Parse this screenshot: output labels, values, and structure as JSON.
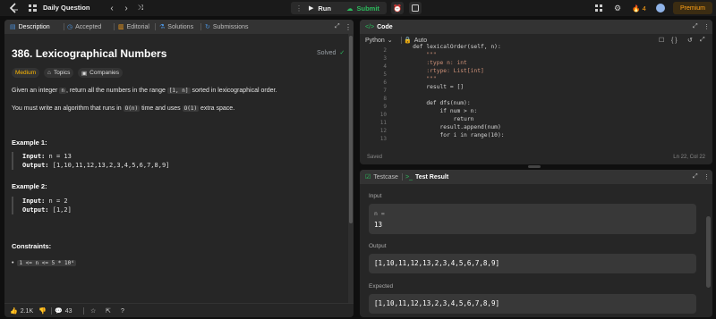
{
  "topbar": {
    "title": "Daily Question",
    "run_label": "Run",
    "submit_label": "Submit",
    "streak": "4",
    "premium_label": "Premium"
  },
  "left_tabs": [
    "Description",
    "Accepted",
    "Editorial",
    "Solutions",
    "Submissions"
  ],
  "problem": {
    "title": "386. Lexicographical Numbers",
    "status": "Solved",
    "difficulty": "Medium",
    "topics_label": "Topics",
    "companies_label": "Companies",
    "p1_a": "Given an integer",
    "p1_code1": "n",
    "p1_b": ", return all the numbers in the range",
    "p1_code2": "[1, n]",
    "p1_c": "sorted in lexicographical order.",
    "p2_a": "You must write an algorithm that runs in",
    "p2_code1": "O(n)",
    "p2_b": "time and uses",
    "p2_code2": "O(1)",
    "p2_c": "extra space.",
    "ex1_title": "Example 1:",
    "ex1_input_label": "Input:",
    "ex1_input": "n = 13",
    "ex1_output_label": "Output:",
    "ex1_output": "[1,10,11,12,13,2,3,4,5,6,7,8,9]",
    "ex2_title": "Example 2:",
    "ex2_input_label": "Input:",
    "ex2_input": "n = 2",
    "ex2_output_label": "Output:",
    "ex2_output": "[1,2]",
    "constraints_title": "Constraints:",
    "constraint_1": "1 <= n <= 5 * 10⁴"
  },
  "footer": {
    "likes": "2.1K",
    "comments": "43"
  },
  "code_panel": {
    "title": "Code",
    "language": "Python",
    "mode": "Auto",
    "saved": "Saved",
    "cursor": "Ln 22, Col 22",
    "line_numbers": [
      "2",
      "3",
      "4",
      "5",
      "6",
      "7",
      "8",
      "9",
      "10",
      "11",
      "12",
      "13"
    ],
    "lines": [
      "    def lexicalOrder(self, n):",
      "        \"\"\"",
      "        :type n: int",
      "        :rtype: List[int]",
      "        \"\"\"",
      "        result = []",
      "",
      "        def dfs(num):",
      "            if num > n:",
      "                return",
      "            result.append(num)",
      "            for i in range(10):"
    ]
  },
  "test_panel": {
    "tab1": "Testcase",
    "tab2": "Test Result",
    "input_label": "Input",
    "input_var": "n =",
    "input_value": "13",
    "output_label": "Output",
    "output_value": "[1,10,11,12,13,2,3,4,5,6,7,8,9]",
    "expected_label": "Expected",
    "expected_value": "[1,10,11,12,13,2,3,4,5,6,7,8,9]"
  },
  "colors": {
    "accent_orange": "#ffa116",
    "submit_green": "#2cbb5d",
    "solved_green": "#2cbb5d",
    "medium_yellow": "#ffb800",
    "tab_blue": "#4a90d9"
  }
}
